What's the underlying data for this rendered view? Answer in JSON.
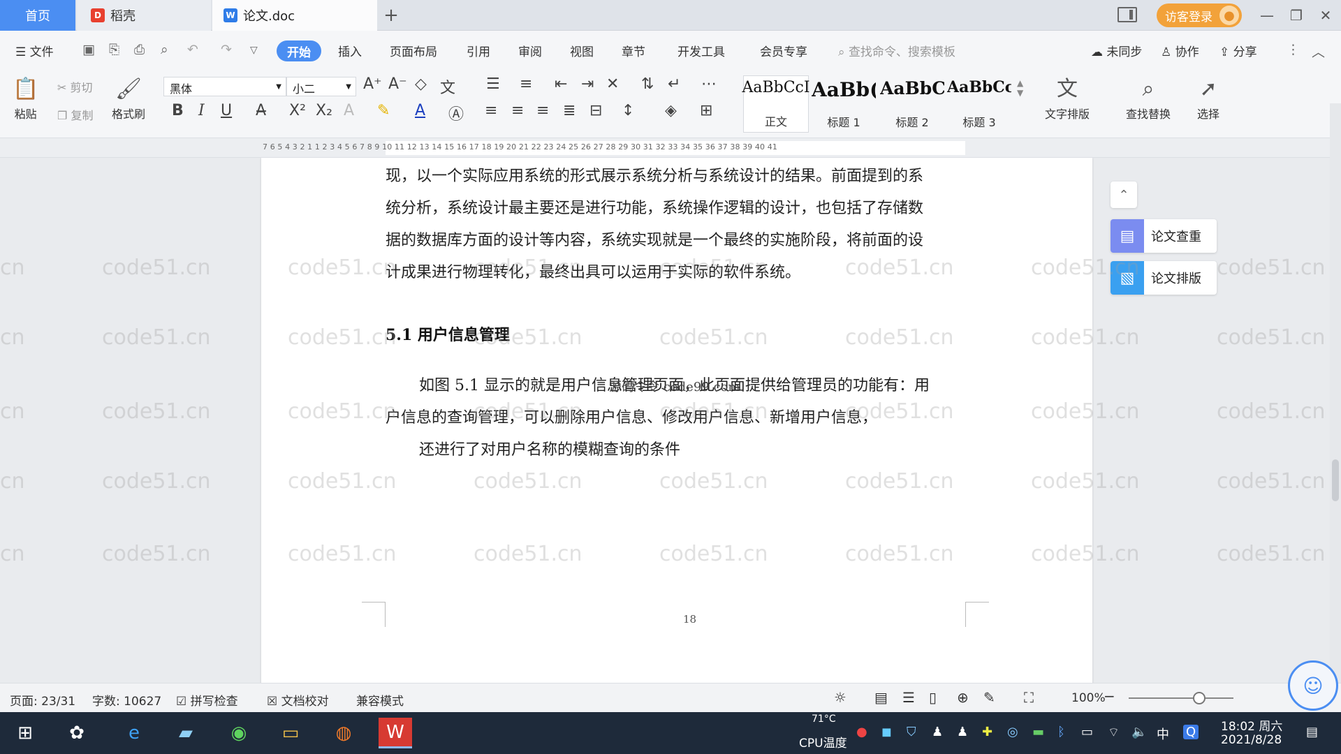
{
  "titlebar": {
    "tabs": [
      {
        "label": "首页"
      },
      {
        "label": "稻壳"
      },
      {
        "label": "论文.doc"
      }
    ],
    "visitor_login": "访客登录"
  },
  "menu": {
    "file": "文件",
    "items": [
      "开始",
      "插入",
      "页面布局",
      "引用",
      "审阅",
      "视图",
      "章节",
      "开发工具",
      "会员专享"
    ],
    "search_placeholder": "查找命令、搜索模板",
    "sync": "未同步",
    "collab": "协作",
    "share": "分享"
  },
  "toolbar": {
    "paste": "粘贴",
    "cut": "剪切",
    "copy": "复制",
    "format_painter": "格式刷",
    "font_name": "黑体",
    "font_size": "小二",
    "styles": [
      {
        "preview": "AaBbCcI",
        "name": "正文"
      },
      {
        "preview": "AaBb(",
        "name": "标题 1"
      },
      {
        "preview": "AaBbC",
        "name": "标题 2"
      },
      {
        "preview": "AaBbCcl",
        "name": "标题 3"
      }
    ],
    "text_layout": "文字排版",
    "find_replace": "查找替换",
    "select": "选择"
  },
  "ruler": {
    "numbers": "7 6 5 4 3 2 1   1 2 3 4 5 6 7 8 9 10 11 12 13 14 15 16 17 18 19 20 21 22 23 24 25 26 27 28 29 30 31 32 33 34 35 36 37 38 39 40 41"
  },
  "document": {
    "paragraph1": [
      "现，以一个实际应用系统的形式展示系统分析与系统设计的结果。前面提到的系",
      "统分析，系统设计最主要还是进行功能，系统操作逻辑的设计，也包括了存储数",
      "据的数据库方面的设计等内容，系统实现就是一个最终的实施阶段，将前面的设",
      "计成果进行物理转化，最终出具可以运用于实际的软件系统。"
    ],
    "heading": "5.1 用户信息管理",
    "overlay": "源码令令 code99 com",
    "paragraph2": [
      "如图 5.1 显示的就是用户信息管理页面，此页面提供给管理员的功能有：用",
      "户信息的查询管理，可以删除用户信息、修改用户信息、新增用户信息，",
      "还进行了对用户名称的模糊查询的条件"
    ],
    "page_number": "18",
    "watermark": "code51.cn"
  },
  "side_panel": {
    "check": "论文查重",
    "format": "论文排版"
  },
  "statusbar": {
    "page": "页面: 23/31",
    "words": "字数: 10627",
    "spell": "拼写检查",
    "proof": "文档校对",
    "compat": "兼容模式",
    "zoom": "100%"
  },
  "taskbar": {
    "cpu_temp": "71°C",
    "cpu_label": "CPU温度",
    "ime": "中",
    "time": "18:02 周六",
    "date": "2021/8/28"
  },
  "colors": {
    "accent": "#4b8ef2",
    "visitor": "#f2a23a",
    "taskbar": "#1e2a3a"
  }
}
